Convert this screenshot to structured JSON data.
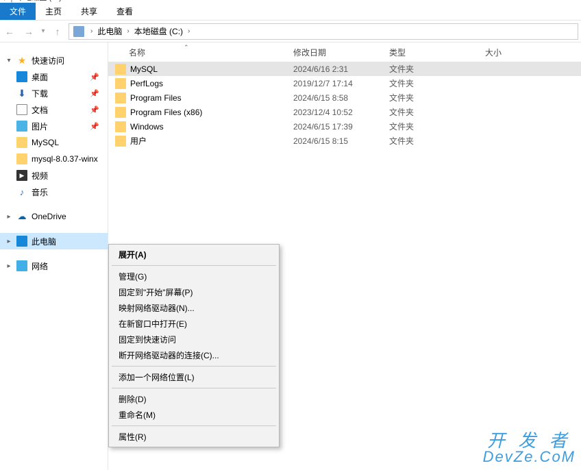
{
  "title_text": "本地磁盘 (C:)",
  "menu": {
    "file": "文件",
    "home": "主页",
    "share": "共享",
    "view": "查看"
  },
  "breadcrumb": {
    "seg1": "此电脑",
    "seg2": "本地磁盘 (C:)"
  },
  "nav": {
    "quick_access": "快速访问",
    "items": [
      {
        "label": "桌面",
        "pinned": true
      },
      {
        "label": "下载",
        "pinned": true
      },
      {
        "label": "文档",
        "pinned": true
      },
      {
        "label": "图片",
        "pinned": true
      },
      {
        "label": "MySQL",
        "pinned": false
      },
      {
        "label": "mysql-8.0.37-winx",
        "pinned": false
      },
      {
        "label": "视频",
        "pinned": false
      },
      {
        "label": "音乐",
        "pinned": false
      }
    ],
    "onedrive": "OneDrive",
    "this_pc": "此电脑",
    "network": "网络"
  },
  "columns": {
    "name": "名称",
    "date": "修改日期",
    "type": "类型",
    "size": "大小"
  },
  "files": [
    {
      "name": "MySQL",
      "date": "2024/6/16 2:31",
      "type": "文件夹",
      "selected": true
    },
    {
      "name": "PerfLogs",
      "date": "2019/12/7 17:14",
      "type": "文件夹",
      "selected": false
    },
    {
      "name": "Program Files",
      "date": "2024/6/15 8:58",
      "type": "文件夹",
      "selected": false
    },
    {
      "name": "Program Files (x86)",
      "date": "2023/12/4 10:52",
      "type": "文件夹",
      "selected": false
    },
    {
      "name": "Windows",
      "date": "2024/6/15 17:39",
      "type": "文件夹",
      "selected": false
    },
    {
      "name": "用户",
      "date": "2024/6/15 8:15",
      "type": "文件夹",
      "selected": false
    }
  ],
  "context_menu": {
    "expand": "展开(A)",
    "manage": "管理(G)",
    "pin_start": "固定到\"开始\"屏幕(P)",
    "map_drive": "映射网络驱动器(N)...",
    "open_new": "在新窗口中打开(E)",
    "pin_quick": "固定到快速访问",
    "disconnect": "断开网络驱动器的连接(C)...",
    "add_location": "添加一个网络位置(L)",
    "delete": "删除(D)",
    "rename": "重命名(M)",
    "properties": "属性(R)"
  },
  "watermark": {
    "line1": "开 发 者",
    "line2": "DevZe.CoM"
  }
}
